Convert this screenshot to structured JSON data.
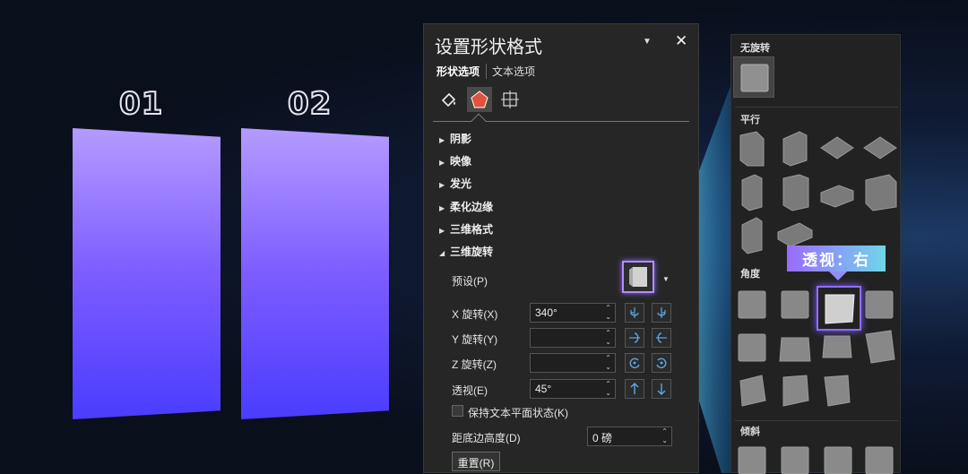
{
  "slide": {
    "label_1": "01",
    "label_2": "02"
  },
  "panel": {
    "title": "设置形状格式",
    "tabs": [
      "形状选项",
      "文本选项"
    ],
    "sections": [
      "阴影",
      "映像",
      "发光",
      "柔化边缘",
      "三维格式",
      "三维旋转"
    ],
    "preset_label": "预设(P)",
    "x_label": "X 旋转(X)",
    "x_value": "340°",
    "y_label": "Y 旋转(Y)",
    "y_value": "",
    "z_label": "Z 旋转(Z)",
    "z_value": "",
    "persp_label": "透视(E)",
    "persp_value": "45°",
    "keep_flat_label": "保持文本平面状态(K)",
    "dist_label": "距底边高度(D)",
    "dist_value": "0 磅",
    "reset_label": "重置(R)"
  },
  "gallery": {
    "groups": [
      "无旋转",
      "平行",
      "角度",
      "倾斜"
    ],
    "tooltip": "透视：右"
  },
  "colors": {
    "accent": "#8f6dff",
    "fill_top": "#b49bff",
    "fill_bottom": "#4a3cff",
    "fill_icon": "#e0533c"
  }
}
